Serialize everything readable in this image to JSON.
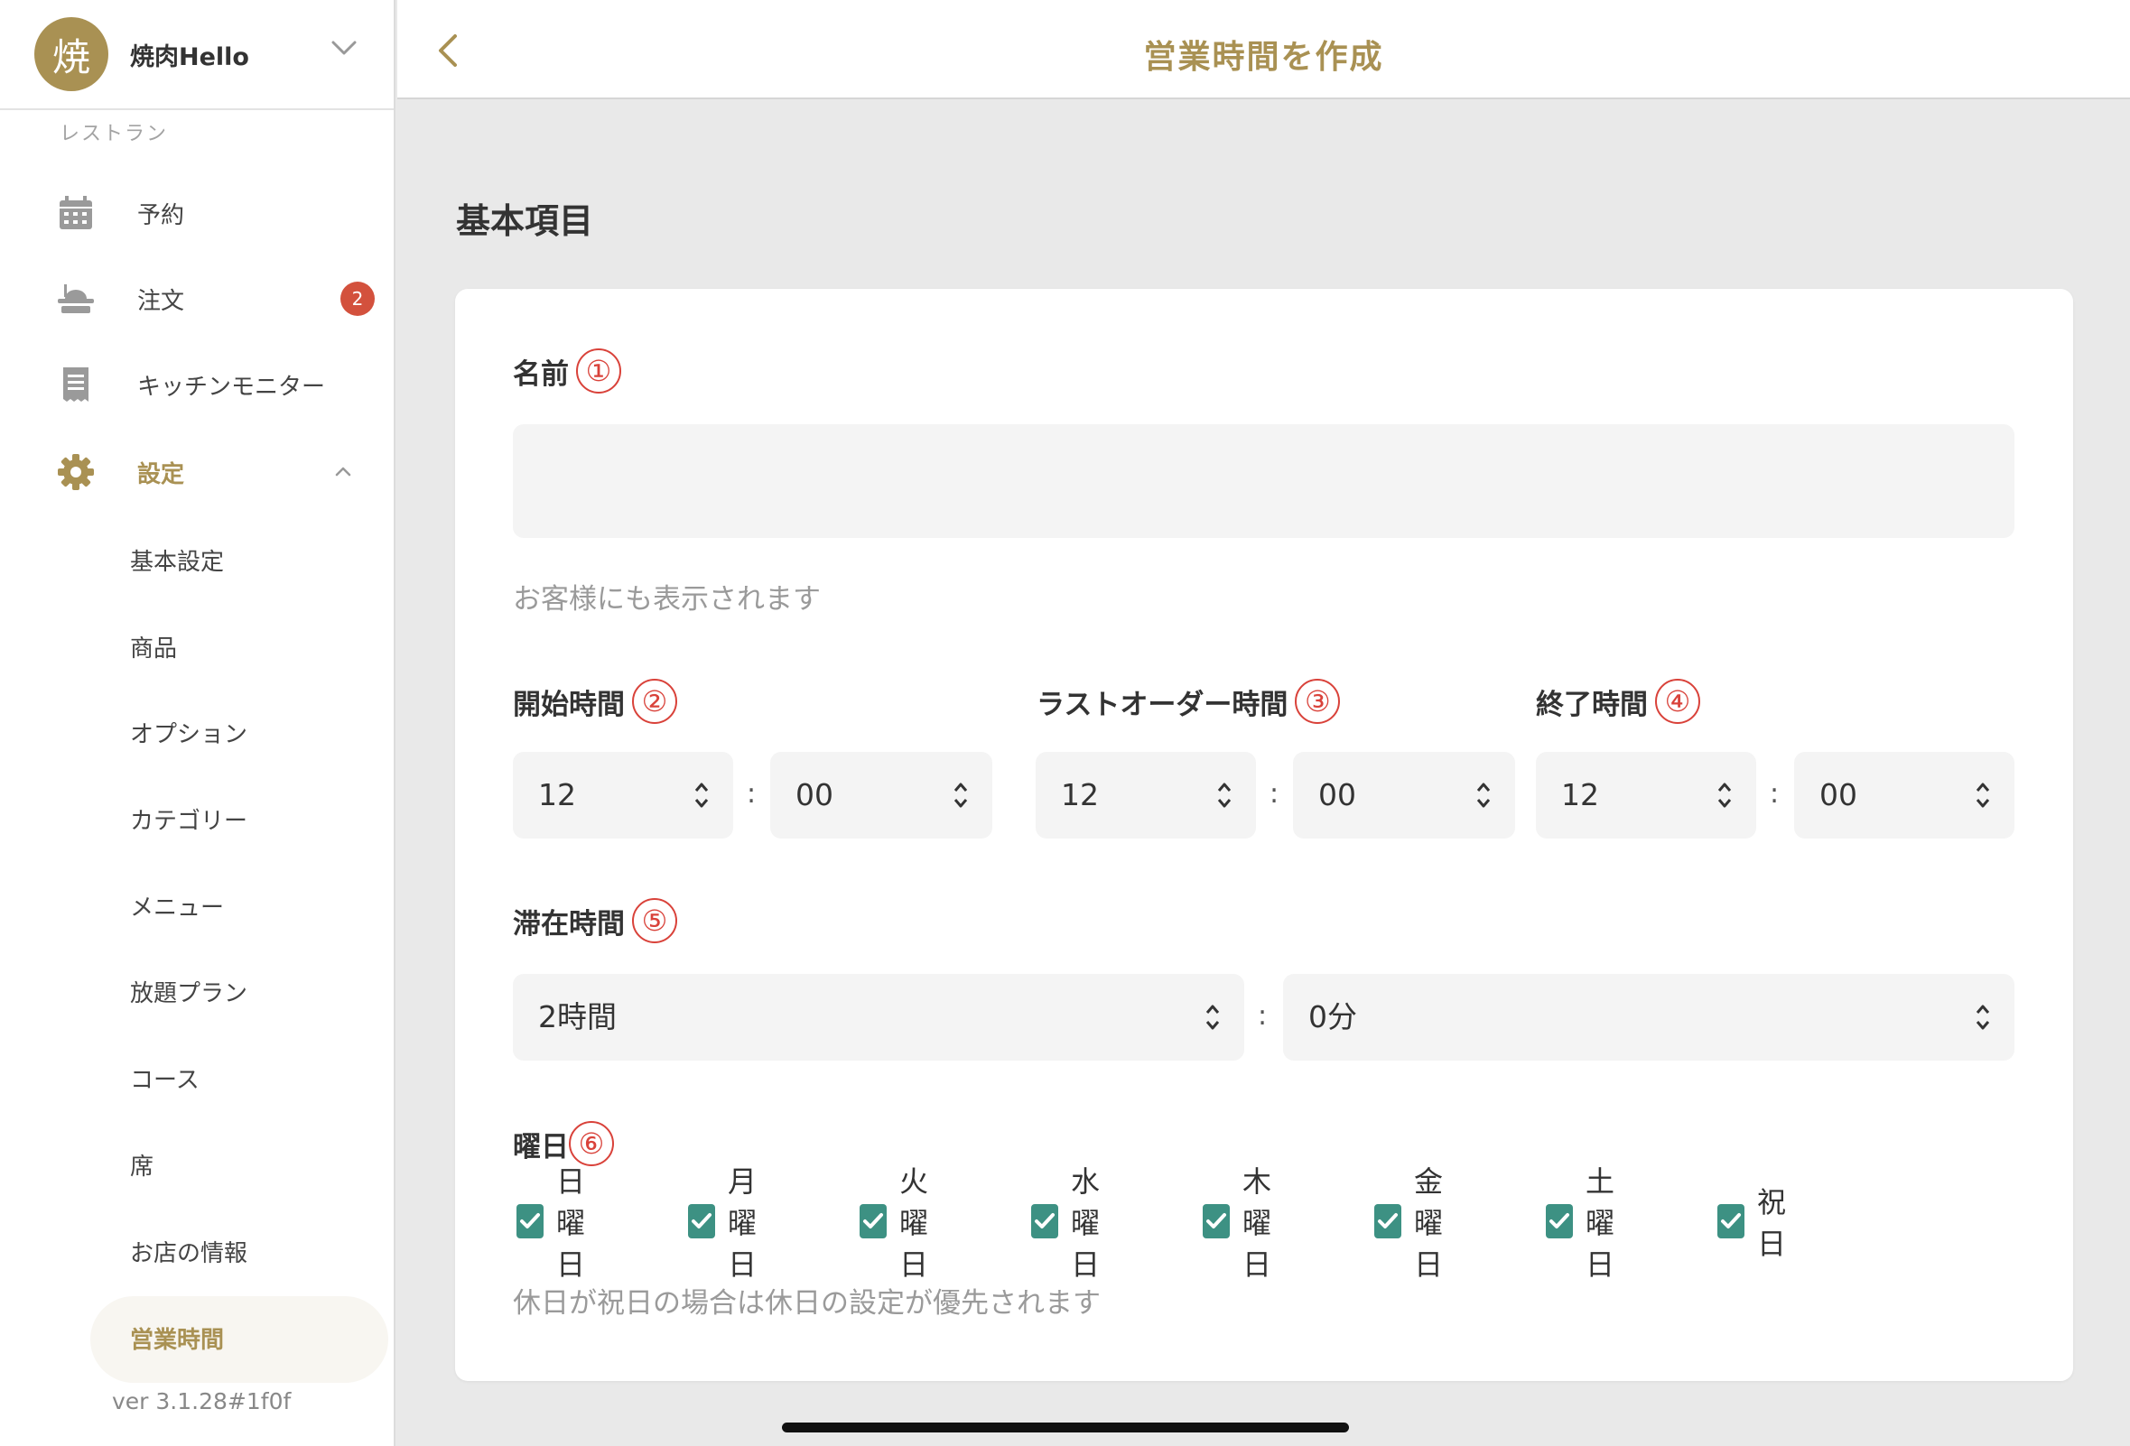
{
  "sidebar": {
    "avatar_char": "焼",
    "shop_name": "焼肉Hello",
    "section_label": "レストラン",
    "items": [
      {
        "label": "予約"
      },
      {
        "label": "注文",
        "badge": "2"
      },
      {
        "label": "キッチンモニター"
      },
      {
        "label": "設定"
      }
    ],
    "sub_items": [
      {
        "label": "基本設定"
      },
      {
        "label": "商品"
      },
      {
        "label": "オプション"
      },
      {
        "label": "カテゴリー"
      },
      {
        "label": "メニュー"
      },
      {
        "label": "放題プラン"
      },
      {
        "label": "コース"
      },
      {
        "label": "席"
      },
      {
        "label": "お店の情報"
      },
      {
        "label": "営業時間"
      }
    ],
    "version": "ver 3.1.28#1f0f"
  },
  "header": {
    "title": "営業時間を作成"
  },
  "main": {
    "section_title": "基本項目",
    "name": {
      "label": "名前",
      "num": "①",
      "value": "",
      "hint": "お客様にも表示されます"
    },
    "start": {
      "label": "開始時間",
      "num": "②",
      "hour": "12",
      "minute": "00"
    },
    "last_order": {
      "label": "ラストオーダー時間",
      "num": "③",
      "hour": "12",
      "minute": "00"
    },
    "end": {
      "label": "終了時間",
      "num": "④",
      "hour": "12",
      "minute": "00"
    },
    "stay": {
      "label": "滞在時間",
      "num": "⑤",
      "hours": "2時間",
      "minutes": "0分"
    },
    "colon": ":",
    "days": {
      "label": "曜日",
      "num": "⑥",
      "items": [
        {
          "label": "日曜日",
          "checked": true
        },
        {
          "label": "月曜日",
          "checked": true
        },
        {
          "label": "火曜日",
          "checked": true
        },
        {
          "label": "水曜日",
          "checked": true
        },
        {
          "label": "木曜日",
          "checked": true
        },
        {
          "label": "金曜日",
          "checked": true
        },
        {
          "label": "土曜日",
          "checked": true
        },
        {
          "label": "祝日",
          "checked": true
        }
      ],
      "hint": "休日が祝日の場合は休日の設定が優先されます"
    }
  },
  "colors": {
    "accent": "#a99153",
    "badge": "#d3513d",
    "checkbox": "#3d9183",
    "annotation": "#d9423a"
  }
}
